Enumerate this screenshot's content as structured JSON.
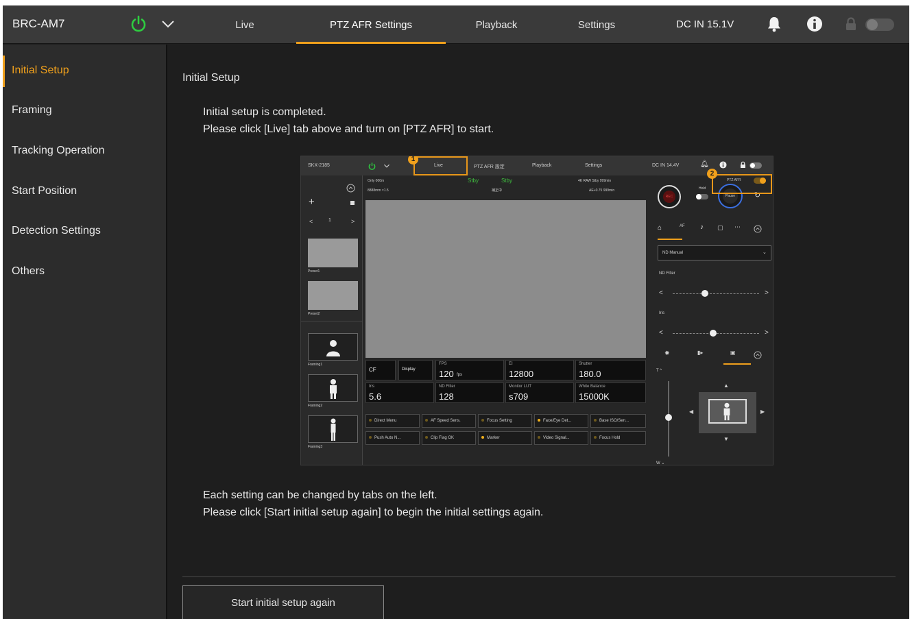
{
  "app": {
    "model": "BRC-AM7",
    "tabs": [
      "Live",
      "PTZ AFR Settings",
      "Playback",
      "Settings"
    ],
    "active_tab": "PTZ AFR Settings",
    "power_input": "DC IN 15.1V"
  },
  "sidebar": {
    "items": [
      "Initial Setup",
      "Framing",
      "Tracking Operation",
      "Start Position",
      "Detection Settings",
      "Others"
    ],
    "active_item": "Initial Setup"
  },
  "main": {
    "title": "Initial Setup",
    "completed_msg_1": "Initial setup is completed.",
    "completed_msg_2": "Please click [Live] tab above and turn on [PTZ AFR] to start.",
    "info_msg_1": "Each setting can be changed by tabs on the left.",
    "info_msg_2": "Please click [Start initial setup again] to begin the initial settings again.",
    "restart_button": "Start initial setup again"
  },
  "embedded_screenshot": {
    "model": "SKX-2185",
    "tabs": [
      "Live",
      "PTZ AFR 設定",
      "Playback",
      "Settings"
    ],
    "power_input": "DC IN 14.4V",
    "badges": [
      "1",
      "2"
    ],
    "status_top_left": "Only 000m",
    "status_top_left_2": "8888mm   ×1.5",
    "standby_1": "Stby",
    "standby_2": "Stby",
    "status_center": "補正中",
    "status_top_right": "4K RAW Stby   999min",
    "status_top_right_2": "AE+0.75   999min",
    "presets": [
      "Preset1",
      "Preset2"
    ],
    "framings": [
      "Framing1",
      "Framing2",
      "Framing3"
    ],
    "preset_nav": "1",
    "buttons": {
      "display": "Display",
      "rec": "REC",
      "pause": "Pause",
      "hold": "Hold",
      "ptz_afr": "PTZ AFR"
    },
    "readouts": [
      {
        "label": "FPS",
        "value": "120",
        "unit": "fps"
      },
      {
        "label": "EI",
        "value": "12800"
      },
      {
        "label": "Shutter",
        "value": "180.0"
      },
      {
        "label": "Iris",
        "value": "5.6"
      },
      {
        "label": "ND Filter",
        "value": "128"
      },
      {
        "label": "Monitor LUT",
        "value": "s709"
      },
      {
        "label": "White Balance",
        "value": "15000K"
      }
    ],
    "assign_buttons": [
      "Direct Menu",
      "AF Speed Sens.",
      "Focus Setting",
      "Face/Eye Det...",
      "Base ISO/Sen...",
      "Push Auto N...",
      "Clip Flag OK",
      "Marker",
      "Video Signal...",
      "Focus Hold"
    ],
    "nd_mode": "ND Manual",
    "nd_filter_label": "ND Filter",
    "iris_label": "Iris"
  },
  "colors": {
    "accent": "#f0a01c",
    "power_green": "#2ecc40",
    "topbar": "#3a3a3a",
    "sidebar": "#2c2c2c",
    "background": "#1e1e1e"
  },
  "icons": [
    "power-icon",
    "chevron-down-icon",
    "bell-icon",
    "info-icon",
    "lock-icon",
    "toggle-switch"
  ]
}
